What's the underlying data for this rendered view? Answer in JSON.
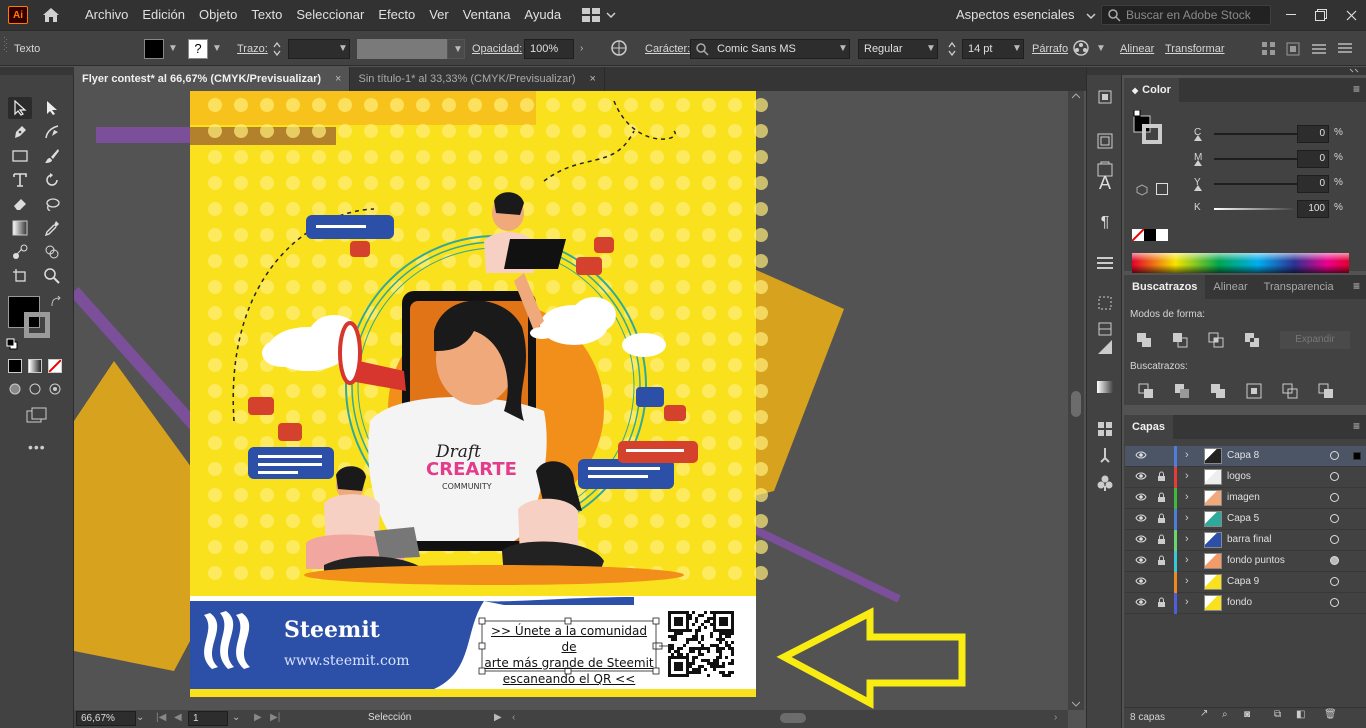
{
  "app": {
    "logo": "Ai"
  },
  "menu": [
    "Archivo",
    "Edición",
    "Objeto",
    "Texto",
    "Seleccionar",
    "Efecto",
    "Ver",
    "Ventana",
    "Ayuda"
  ],
  "workspace": "Aspectos esenciales",
  "stock_search": {
    "placeholder": "Buscar en Adobe Stock"
  },
  "control_bar": {
    "context": "Texto",
    "trazo_label": "Trazo:",
    "opacidad_label": "Opacidad:",
    "opacidad_value": "100%",
    "caracter_label": "Carácter:",
    "font_family": "Comic Sans MS",
    "font_style": "Regular",
    "font_size": "14 pt",
    "parrafo_label": "Párrafo",
    "alinear_label": "Alinear",
    "transformar_label": "Transformar"
  },
  "tabs": [
    {
      "label": "Flyer contest* al 66,67% (CMYK/Previsualizar)",
      "close": "×"
    },
    {
      "label": "Sin título-1* al 33,33% (CMYK/Previsualizar)",
      "close": "×"
    }
  ],
  "artboard": {
    "steemit_title": "Steemit",
    "steemit_url": "www.steemit.com",
    "text_line1": ">> Únete a la comunidad de",
    "text_line2": "arte más grande de Steemit",
    "text_line3": "escaneando el QR <<",
    "shirt_line1": "Draft",
    "shirt_line2": "CREARTE",
    "shirt_line3": "COMMUNITY"
  },
  "status_bar": {
    "zoom": "66,67%",
    "page": "1",
    "tool": "Selección"
  },
  "color_panel": {
    "title": "Color",
    "rows": [
      {
        "label": "C",
        "value": "0",
        "unit": "%"
      },
      {
        "label": "M",
        "value": "0",
        "unit": "%"
      },
      {
        "label": "Y",
        "value": "0",
        "unit": "%"
      },
      {
        "label": "K",
        "value": "100",
        "unit": "%"
      }
    ]
  },
  "pathfinder_panel": {
    "tabs": [
      "Buscatrazos",
      "Alinear",
      "Transparencia"
    ],
    "shape_modes_label": "Modos de forma:",
    "expand_label": "Expandir",
    "pathfinders_label": "Buscatrazos:"
  },
  "layers_panel": {
    "title": "Capas",
    "layers": [
      {
        "name": "Capa 8",
        "color": "#4f7ddc",
        "locked": false,
        "selected": true
      },
      {
        "name": "logos",
        "color": "#e53b3b",
        "locked": true,
        "selected": false
      },
      {
        "name": "imagen",
        "color": "#3bbd3b",
        "locked": true,
        "selected": false
      },
      {
        "name": "Capa 5",
        "color": "#4f7ddc",
        "locked": true,
        "selected": false
      },
      {
        "name": "barra final",
        "color": "#6bd66b",
        "locked": true,
        "selected": false
      },
      {
        "name": "fondo puntos",
        "color": "#37c7d6",
        "locked": true,
        "selected": false
      },
      {
        "name": "Capa 9",
        "color": "#f08a1e",
        "locked": false,
        "selected": false
      },
      {
        "name": "fondo",
        "color": "#4f5ddc",
        "locked": true,
        "selected": false
      }
    ],
    "count": "8 capas"
  }
}
